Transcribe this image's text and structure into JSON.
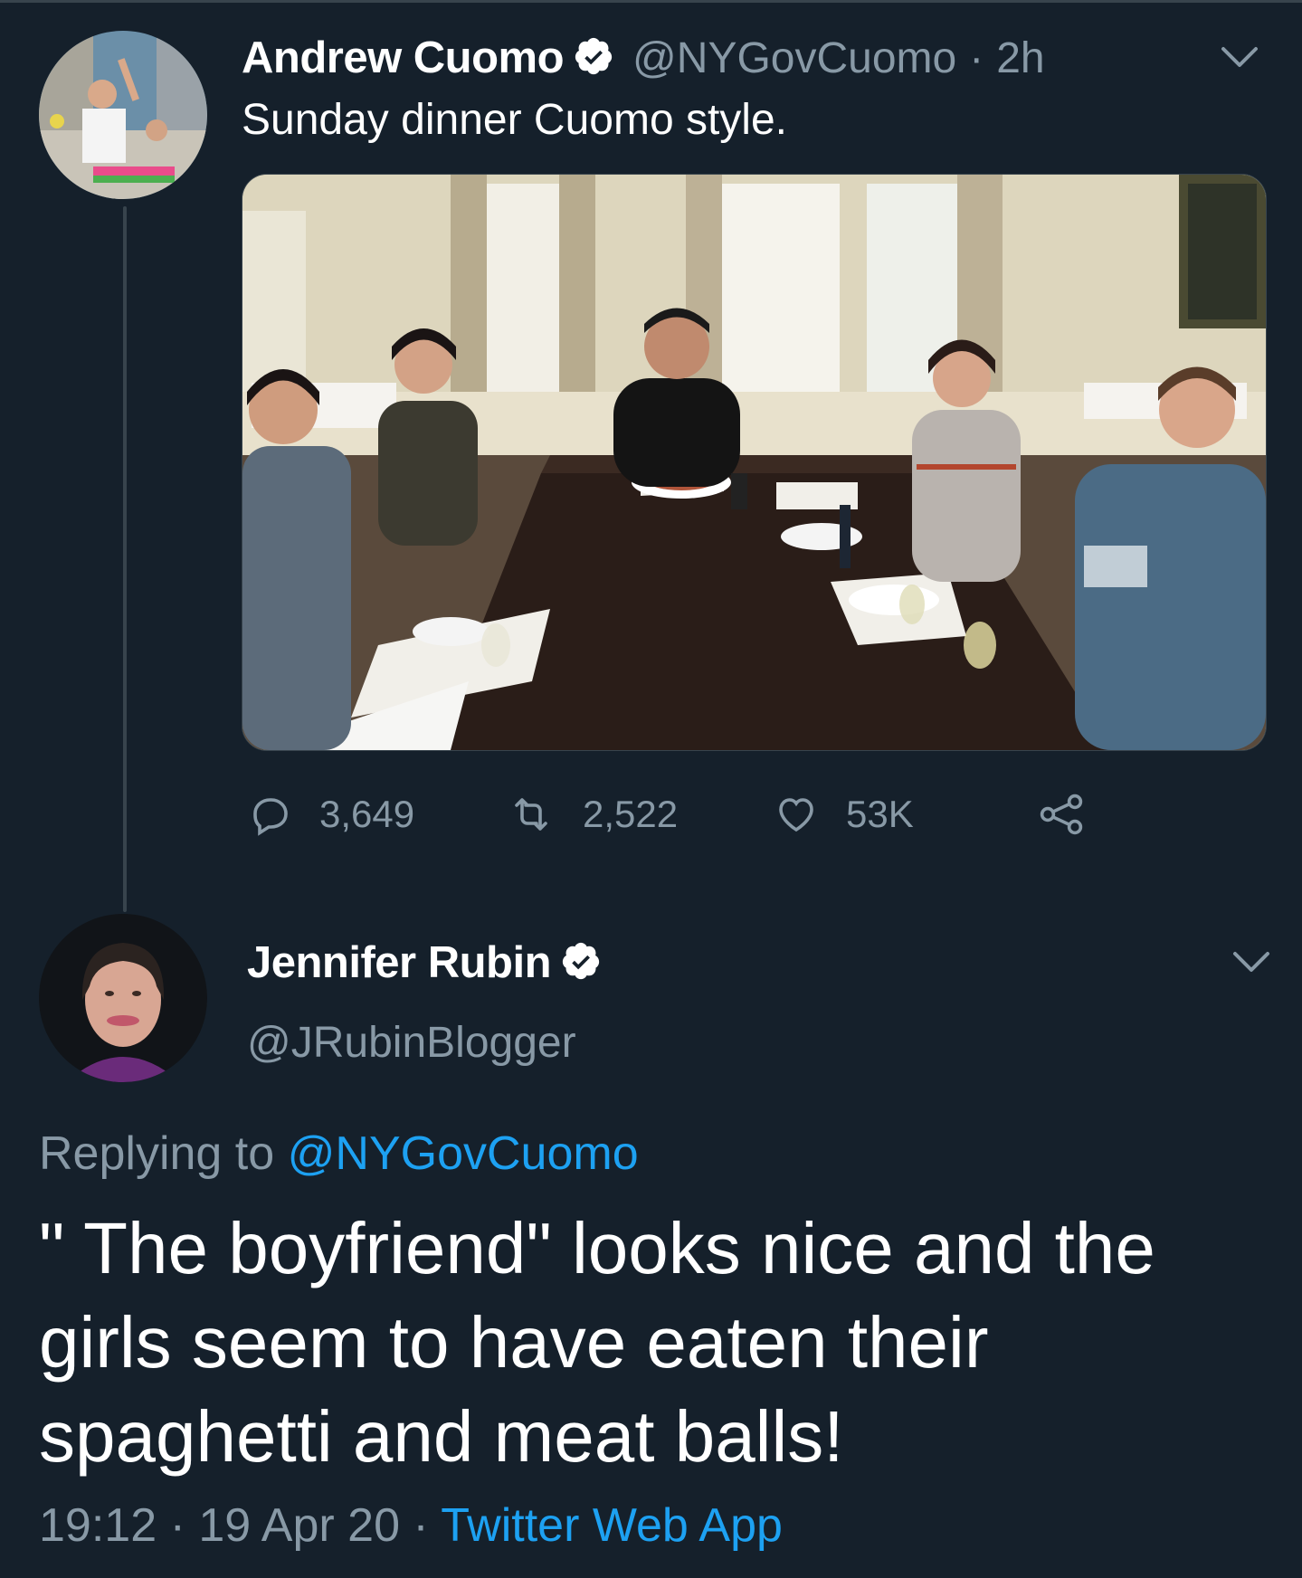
{
  "tweet": {
    "author_name": "Andrew Cuomo",
    "handle": "@NYGovCuomo",
    "separator": "·",
    "time": "2h",
    "text": "Sunday dinner Cuomo style.",
    "photo_description": "family-dinner-photo",
    "actions": {
      "replies": "3,649",
      "retweets": "2,522",
      "likes": "53K"
    }
  },
  "reply": {
    "author_name": "Jennifer Rubin",
    "handle": "@JRubinBlogger",
    "replying_prefix": "Replying to ",
    "replying_handle": "@NYGovCuomo",
    "text": "\" The boyfriend\" looks nice and the girls seem to have eaten their spaghetti and meat balls!",
    "time": "19:12",
    "sep1": " · ",
    "date": "19 Apr 20",
    "sep2": " · ",
    "source": "Twitter Web App"
  },
  "colors": {
    "background": "#15202b",
    "secondary_text": "#8899a6",
    "link": "#1da1f2",
    "divider": "#38444d"
  }
}
